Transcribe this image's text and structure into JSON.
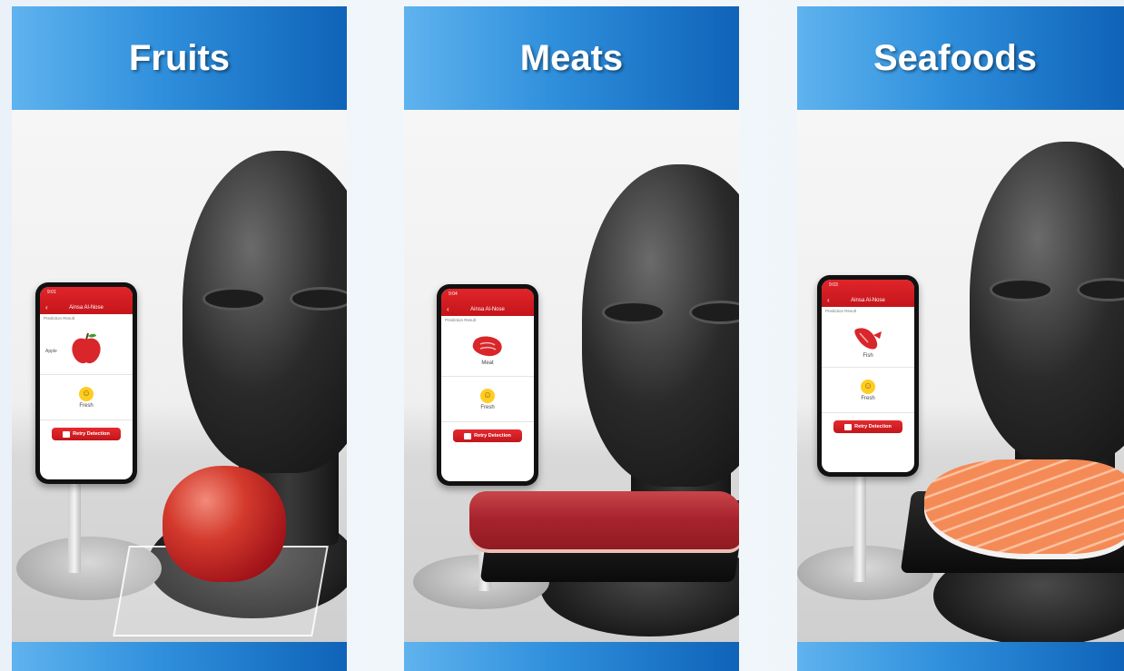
{
  "panels": [
    {
      "title": "Fruits",
      "phone": {
        "app_title": "Ainsa Al-Nose",
        "time": "9:01",
        "subtitle": "Prediction Result",
        "item_label": "Apple",
        "item_caption": "",
        "freshness": "Fresh",
        "button": "Retry Detection"
      }
    },
    {
      "title": "Meats",
      "phone": {
        "app_title": "Ainsa Al-Nose",
        "time": "9:04",
        "subtitle": "Prediction Result",
        "item_label": "",
        "item_caption": "Meat",
        "freshness": "Fresh",
        "button": "Retry Detection"
      }
    },
    {
      "title": "Seafoods",
      "phone": {
        "app_title": "Ainsa Al-Nose",
        "time": "9:03",
        "subtitle": "Prediction Result",
        "item_label": "",
        "item_caption": "Fish",
        "freshness": "Fresh",
        "button": "Retry Detection"
      }
    }
  ],
  "colors": {
    "header_gradient_start": "#5fb3ee",
    "header_gradient_end": "#0f63b8",
    "app_accent": "#d01c22"
  },
  "icons": {
    "fruit": "apple-icon",
    "meat": "steak-icon",
    "seafood": "fish-icon",
    "freshness": "smiley-icon",
    "retry": "retry-icon"
  }
}
